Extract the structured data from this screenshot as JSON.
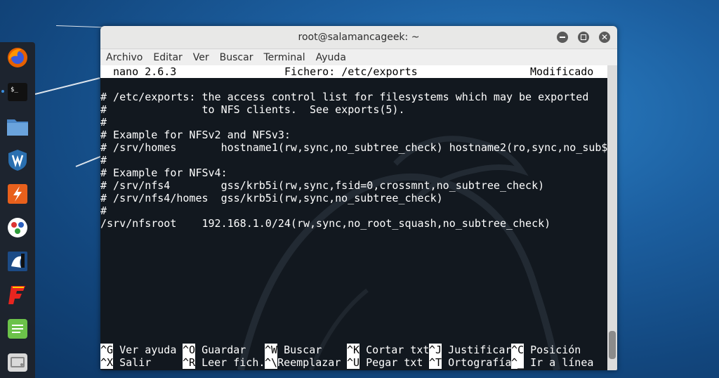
{
  "window": {
    "title": "root@salamancageek: ~",
    "buttons": [
      "minimize",
      "maximize",
      "close"
    ]
  },
  "menu": [
    "Archivo",
    "Editar",
    "Ver",
    "Buscar",
    "Terminal",
    "Ayuda"
  ],
  "nano": {
    "version": "nano 2.6.3",
    "file": "Fichero: /etc/exports",
    "state": "Modificado"
  },
  "file_lines": [
    "# /etc/exports: the access control list for filesystems which may be exported",
    "#               to NFS clients.  See exports(5).",
    "#",
    "# Example for NFSv2 and NFSv3:",
    "# /srv/homes       hostname1(rw,sync,no_subtree_check) hostname2(ro,sync,no_sub$",
    "#",
    "# Example for NFSv4:",
    "# /srv/nfs4        gss/krb5i(rw,sync,fsid=0,crossmnt,no_subtree_check)",
    "# /srv/nfs4/homes  gss/krb5i(rw,sync,no_subtree_check)",
    "#",
    "/srv/nfsroot    192.168.1.0/24(rw,sync,no_root_squash,no_subtree_check)"
  ],
  "shortcuts": [
    [
      {
        "key": "^G",
        "label": "Ver ayuda"
      },
      {
        "key": "^O",
        "label": "Guardar"
      },
      {
        "key": "^W",
        "label": "Buscar"
      },
      {
        "key": "^K",
        "label": "Cortar txt"
      },
      {
        "key": "^J",
        "label": "Justificar"
      },
      {
        "key": "^C",
        "label": "Posición"
      }
    ],
    [
      {
        "key": "^X",
        "label": "Salir"
      },
      {
        "key": "^R",
        "label": "Leer fich."
      },
      {
        "key": "^\\",
        "label": "Reemplazar"
      },
      {
        "key": "^U",
        "label": "Pegar txt"
      },
      {
        "key": "^T",
        "label": "Ortografía"
      },
      {
        "key": "^_",
        "label": "Ir a línea"
      }
    ]
  ],
  "dock": [
    "firefox-icon",
    "terminal-icon",
    "files-icon",
    "metasploit-icon",
    "burpsuite-icon",
    "maltego-icon",
    "armitage-icon",
    "faraday-icon",
    "leafpad-icon",
    "app-grid-icon"
  ],
  "colors": {
    "terminal_bg": "#12181f",
    "titlebar": "#e8e8e7",
    "dock": "#1e2228"
  }
}
